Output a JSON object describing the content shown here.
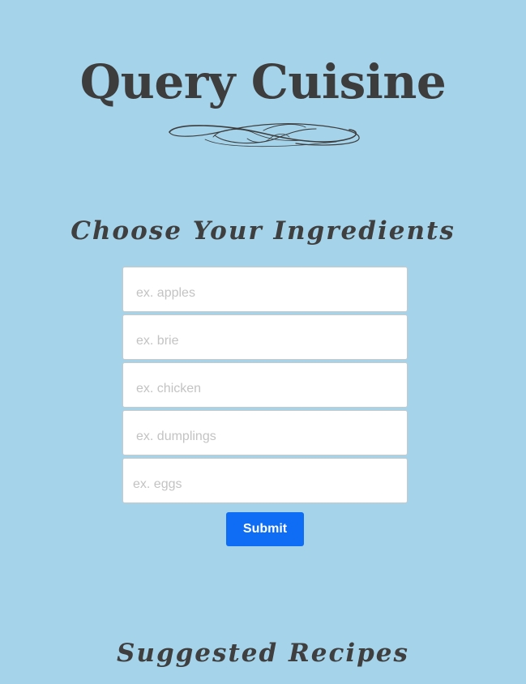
{
  "header": {
    "title": "Query Cuisine"
  },
  "ingredients_section": {
    "heading": "Choose Your Ingredients",
    "inputs": [
      {
        "placeholder": "ex. apples",
        "value": ""
      },
      {
        "placeholder": "ex. brie",
        "value": ""
      },
      {
        "placeholder": "ex. chicken",
        "value": ""
      },
      {
        "placeholder": "ex. dumplings",
        "value": ""
      },
      {
        "placeholder": "ex. eggs",
        "value": ""
      }
    ],
    "submit_label": "Submit"
  },
  "recipes_section": {
    "heading": "Suggested Recipes"
  },
  "colors": {
    "background": "#a5d3ea",
    "text": "#3f3f3f",
    "button": "#0f6cf5",
    "button_text": "#ffffff",
    "input_border": "#c9c9c9",
    "placeholder": "#c3c3c3"
  },
  "icons": {
    "divider": "ornamental-flourish-divider"
  }
}
